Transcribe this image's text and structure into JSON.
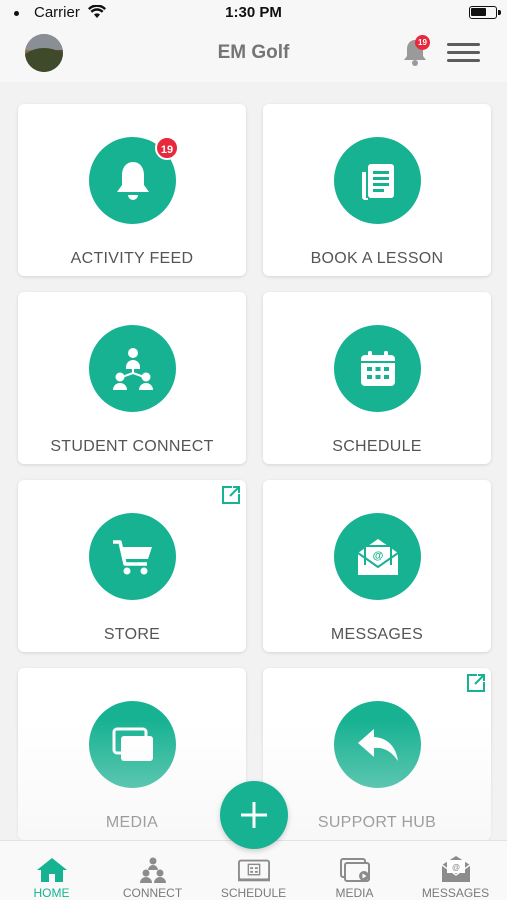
{
  "status_bar": {
    "carrier": "Carrier",
    "time": "1:30 PM"
  },
  "header": {
    "title": "EM Golf",
    "notification_count": "19"
  },
  "tiles": [
    {
      "label": "ACTIVITY FEED",
      "icon": "bell-icon",
      "badge": "19"
    },
    {
      "label": "BOOK A LESSON",
      "icon": "document-icon"
    },
    {
      "label": "STUDENT CONNECT",
      "icon": "people-network-icon"
    },
    {
      "label": "SCHEDULE",
      "icon": "calendar-icon"
    },
    {
      "label": "STORE",
      "icon": "cart-icon",
      "external": true
    },
    {
      "label": "MESSAGES",
      "icon": "envelope-icon"
    },
    {
      "label": "MEDIA",
      "icon": "media-icon"
    },
    {
      "label": "SUPPORT HUB",
      "icon": "reply-icon",
      "external": true
    }
  ],
  "tabbar": {
    "tabs": [
      {
        "label": "HOME",
        "icon": "home-icon",
        "active": true
      },
      {
        "label": "CONNECT",
        "icon": "people-icon"
      },
      {
        "label": "SCHEDULE",
        "icon": "calendar-icon"
      },
      {
        "label": "MEDIA",
        "icon": "media-play-icon"
      },
      {
        "label": "MESSAGES",
        "icon": "envelope-icon"
      }
    ]
  },
  "colors": {
    "accent": "#17b292",
    "badge": "#e8283c",
    "background": "#f2f2f2"
  }
}
